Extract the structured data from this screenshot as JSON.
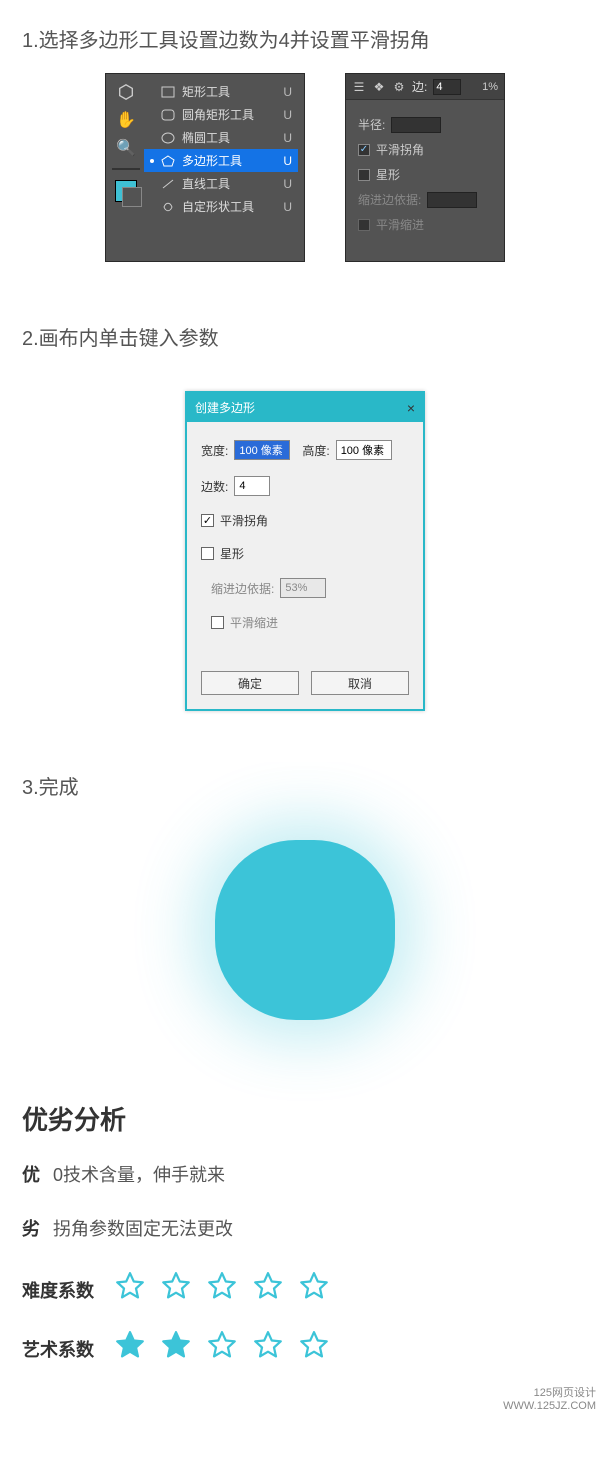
{
  "step1_title": "1.选择多边形工具设置边数为4并设置平滑拐角",
  "step2_title": "2.画布内单击键入参数",
  "step3_title": "3.完成",
  "tools": {
    "items": [
      {
        "name": "矩形工具",
        "short": "U",
        "sel": false
      },
      {
        "name": "圆角矩形工具",
        "short": "U",
        "sel": false
      },
      {
        "name": "椭圆工具",
        "short": "U",
        "sel": false
      },
      {
        "name": "多边形工具",
        "short": "U",
        "sel": true
      },
      {
        "name": "直线工具",
        "short": "U",
        "sel": false
      },
      {
        "name": "自定形状工具",
        "short": "U",
        "sel": false
      }
    ]
  },
  "opts": {
    "sides_label": "边:",
    "sides_value": "4",
    "pct": "1%",
    "radius_label": "半径:",
    "radius_value": "",
    "smooth_label": "平滑拐角",
    "star_label": "星形",
    "indent_label": "缩进边依据:",
    "indent_value": "",
    "smooth_indent_label": "平滑缩进"
  },
  "dialog": {
    "title": "创建多边形",
    "close": "×",
    "width_label": "宽度:",
    "width_value": "100 像素",
    "height_label": "高度:",
    "height_value": "100 像素",
    "sides_label": "边数:",
    "sides_value": "4",
    "smooth_label": "平滑拐角",
    "star_label": "星形",
    "indent_label": "缩进边依据:",
    "indent_value": "53%",
    "smooth_indent_label": "平滑缩进",
    "ok": "确定",
    "cancel": "取消"
  },
  "analysis": {
    "heading": "优劣分析",
    "pro_label": "优",
    "pro_text": "0技术含量，伸手就来",
    "con_label": "劣",
    "con_text": "拐角参数固定无法更改",
    "difficulty_label": "难度系数",
    "art_label": "艺术系数"
  },
  "footer": {
    "line1": "125网页设计",
    "line2": "WWW.125JZ.COM"
  },
  "ratings": {
    "difficulty": 0,
    "art": 2,
    "max": 5
  },
  "colors": {
    "teal": "#3cc4d8",
    "tealDialog": "#29b8c8"
  }
}
